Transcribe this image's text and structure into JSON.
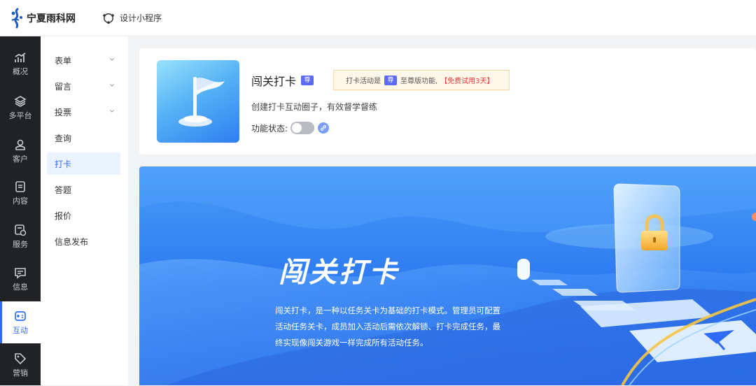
{
  "header": {
    "logo_text": "宁夏雨科网",
    "miniapp_label": "设计小程序"
  },
  "nav": {
    "items": [
      {
        "label": "概况",
        "icon": "chart-icon"
      },
      {
        "label": "多平台",
        "icon": "layers-icon"
      },
      {
        "label": "客户",
        "icon": "user-icon"
      },
      {
        "label": "内容",
        "icon": "document-icon"
      },
      {
        "label": "服务",
        "icon": "service-icon"
      },
      {
        "label": "信息",
        "icon": "message-icon"
      },
      {
        "label": "互动",
        "icon": "gamepad-icon"
      },
      {
        "label": "营销",
        "icon": "tag-icon"
      }
    ],
    "active": "互动"
  },
  "submenu": {
    "items": [
      {
        "label": "表单",
        "expandable": true
      },
      {
        "label": "留言",
        "expandable": true
      },
      {
        "label": "投票",
        "expandable": true
      },
      {
        "label": "查询",
        "expandable": false
      },
      {
        "label": "打卡",
        "expandable": false
      },
      {
        "label": "答题",
        "expandable": false
      },
      {
        "label": "报价",
        "expandable": false
      },
      {
        "label": "信息发布",
        "expandable": false
      }
    ],
    "active": "打卡"
  },
  "feature": {
    "title": "闯关打卡",
    "vip_badge": "尊",
    "promo_prefix": "打卡活动是",
    "promo_suffix": "至尊版功能,",
    "promo_trial": "【免费试用3天】",
    "description": "创建打卡互动圈子，有效督学督练",
    "status_label": "功能状态:",
    "enabled": false
  },
  "banner": {
    "title": "闯关打卡",
    "description": "闯关打卡，是一种以任务关卡为基础的打卡模式。管理员可配置活动任务关卡，成员加入活动后需依次解锁、打卡完成任务，最终实现像闯关游戏一样完成所有活动任务。"
  },
  "colors": {
    "accent": "#2f6cf6",
    "nav_bg": "#202226",
    "trial_red": "#e43b3b",
    "vip_purple": "#5b6bf5"
  }
}
